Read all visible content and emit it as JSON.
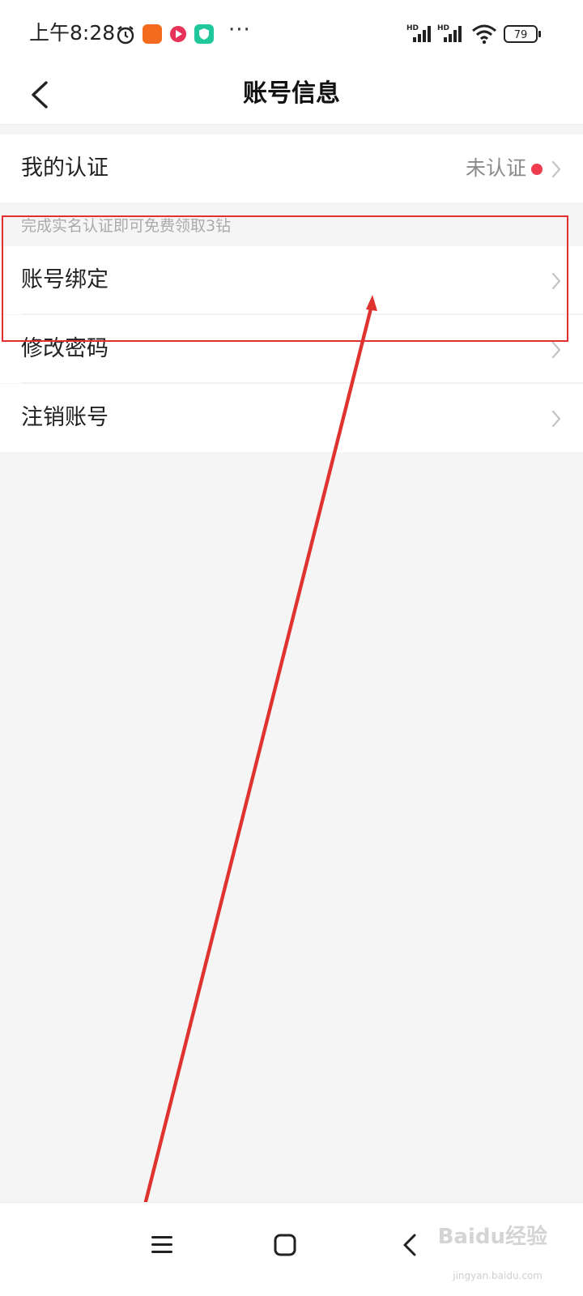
{
  "status_bar": {
    "time": "上午8:28",
    "battery": "79",
    "more": "···",
    "signal_label": "HD"
  },
  "header": {
    "title": "账号信息"
  },
  "rows": [
    {
      "label": "我的认证",
      "status": "未认证"
    },
    {
      "label": "账号绑定"
    },
    {
      "label": "修改密码"
    },
    {
      "label": "注销账号"
    }
  ],
  "hint": "完成实名认证即可免费领取3钻",
  "watermark": {
    "text": "Baidu经验",
    "url_text": "jingyan.baidu.com"
  },
  "colors": {
    "accent_red": "#e0322f",
    "badge_red": "#ee3b4e",
    "background": "#f5f5f5"
  }
}
